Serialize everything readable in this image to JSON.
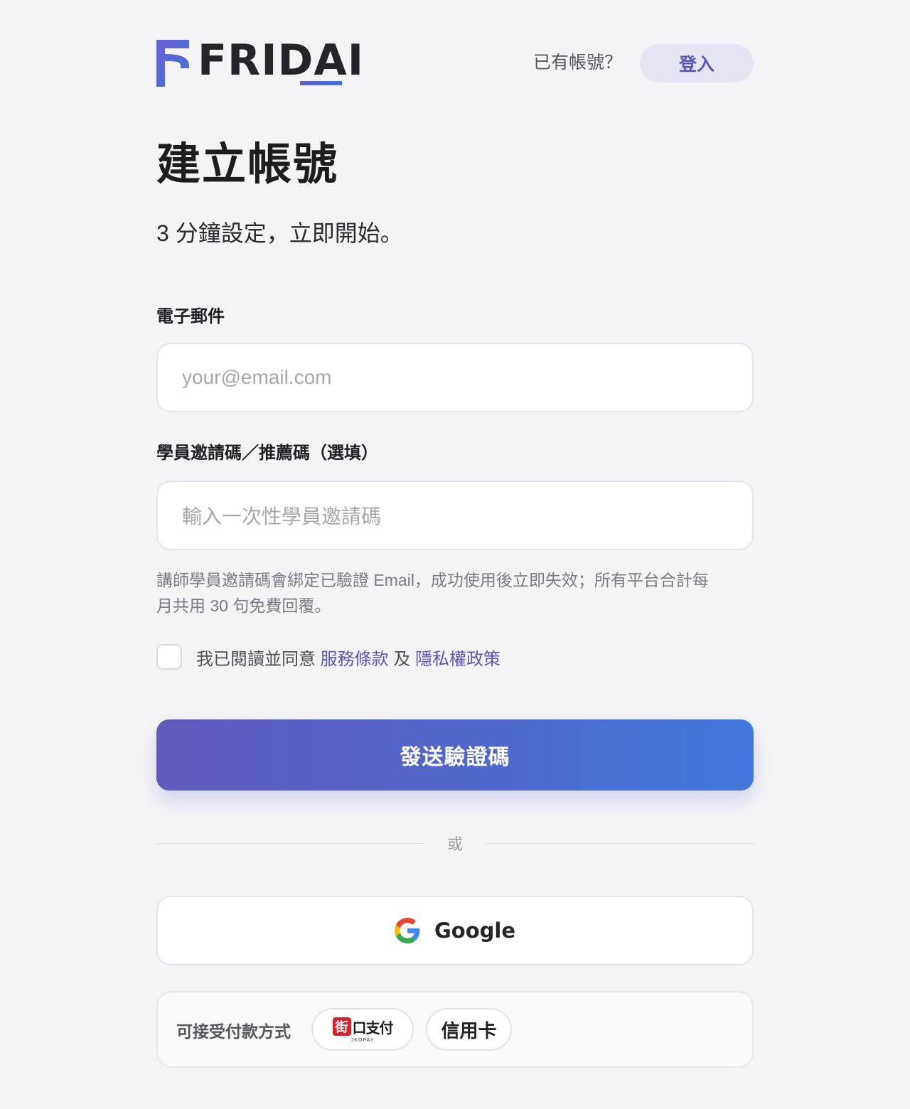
{
  "header": {
    "logo_text": "FRIDAI",
    "have_account": "已有帳號？",
    "login_label": "登入"
  },
  "main": {
    "title": "建立帳號",
    "subtitle": "3 分鐘設定，立即開始。",
    "email": {
      "label": "電子郵件",
      "placeholder": "your@email.com",
      "value": ""
    },
    "invite_code": {
      "label": "學員邀請碼／推薦碼（選填）",
      "placeholder": "輸入一次性學員邀請碼",
      "value": ""
    },
    "help_line1": "講師學員邀請碼會綁定已驗證 Email，成功使用後立即失效；所有平台合計每",
    "help_line2": "月共用 30 句免費回覆。",
    "agree": {
      "checked": false,
      "prefix": "我已閱讀並同意",
      "terms_link": "服務條款",
      "and": "及",
      "privacy_link": "隱私權政策"
    },
    "send_button": "發送驗證碼",
    "divider_text": "或",
    "google_button": "Google"
  },
  "payment": {
    "label": "可接受付款方式",
    "methods": [
      {
        "name": "jkopay",
        "mark": "街",
        "text": "口支付",
        "subtext": "JKOPAY"
      },
      {
        "name": "credit-card",
        "text": "信用卡"
      }
    ]
  },
  "colors": {
    "accent": "#5b56b5",
    "button_gradient_start": "#625bbb",
    "button_gradient_end": "#4177dc",
    "background": "#f4f4f7"
  },
  "icons": {
    "logo": "fridai-logo-icon",
    "google": "google-icon",
    "jkopay": "jkopay-logo-icon"
  }
}
